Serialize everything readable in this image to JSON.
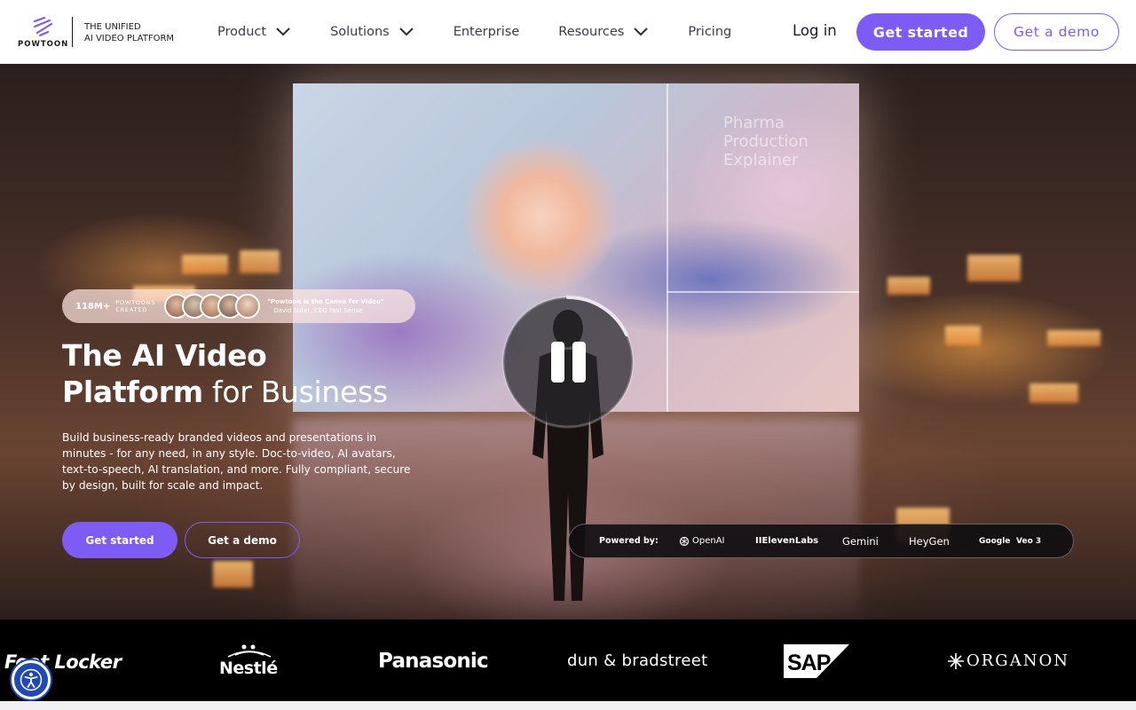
{
  "brand": {
    "name": "POWTOON",
    "tagline_line1": "THE UNIFIED",
    "tagline_line2": "AI VIDEO PLATFORM",
    "accent": "#7c5cf5"
  },
  "nav": {
    "items": [
      {
        "label": "Product",
        "has_dropdown": true
      },
      {
        "label": "Solutions",
        "has_dropdown": true
      },
      {
        "label": "Enterprise",
        "has_dropdown": false
      },
      {
        "label": "Resources",
        "has_dropdown": true
      },
      {
        "label": "Pricing",
        "has_dropdown": false
      }
    ],
    "login": "Log in",
    "get_started": "Get started",
    "get_demo": "Get a demo"
  },
  "hero": {
    "video_overlay_line1": "Pharma",
    "video_overlay_line2": "Production",
    "video_overlay_line3": "Explainer",
    "pill": {
      "count": "118M+",
      "count_label_line1": "POWTOONS",
      "count_label_line2": "CREATED",
      "quote": "\"Powtoon is the Canva for Video\"",
      "attribution": "David Suter, CEO Fast Sense"
    },
    "headline_bold_line1": "The AI Video",
    "headline_bold_line2": "Platform",
    "headline_light": " for Business",
    "subcopy": "Build business-ready branded videos and presentations in minutes - for any need, in any style. Doc-to-video, AI avatars, text-to-speech, AI translation, and more. Fully compliant, secure by design, built for scale and impact.",
    "cta_primary": "Get started",
    "cta_secondary": "Get a demo",
    "video_state": "playing",
    "pause_icon": "pause-icon"
  },
  "powered_by": {
    "label": "Powered by:",
    "partners": [
      "OpenAI",
      "IIElevenLabs",
      "Gemini",
      "HeyGen",
      "Google",
      "Veo 3"
    ]
  },
  "customer_logos": [
    "Foot Locker",
    "Nestlé",
    "Panasonic",
    "dun & bradstreet",
    "SAP",
    "ORGANON"
  ],
  "accessibility_icon": "accessibility-icon"
}
